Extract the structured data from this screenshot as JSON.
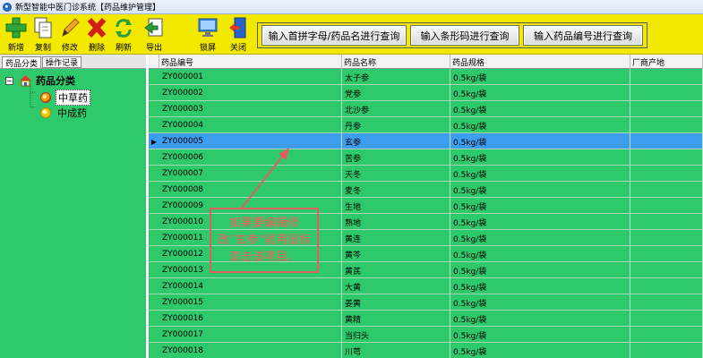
{
  "window": {
    "title": "新型智能中医门诊系统【药品维护管理】"
  },
  "toolbar": {
    "add": "新增",
    "copy": "复制",
    "edit": "修改",
    "delete": "删除",
    "refresh": "刷新",
    "export": "导出",
    "lock": "锁屏",
    "close": "关闭",
    "query_pinyin": "输入首拼字母/药品名进行查询",
    "query_barcode": "输入条形码进行查询",
    "query_code": "输入药品编号进行查询"
  },
  "left": {
    "tabs": [
      "药品分类",
      "操作记录"
    ],
    "tree_root": "药品分类",
    "tree_items": [
      "中草药",
      "中成药"
    ]
  },
  "grid": {
    "columns": [
      "药品编号",
      "药品名称",
      "药品规格",
      "厂商产地"
    ],
    "rows": [
      [
        "ZY000001",
        "太子参",
        "0.5kg/袋",
        ""
      ],
      [
        "ZY000002",
        "党参",
        "0.5kg/袋",
        ""
      ],
      [
        "ZY000003",
        "北沙参",
        "0.5kg/袋",
        ""
      ],
      [
        "ZY000004",
        "丹参",
        "0.5kg/袋",
        ""
      ],
      [
        "ZY000005",
        "玄参",
        "0.5kg/袋",
        ""
      ],
      [
        "ZY000006",
        "苦参",
        "0.5kg/袋",
        ""
      ],
      [
        "ZY000007",
        "天冬",
        "0.5kg/袋",
        ""
      ],
      [
        "ZY000008",
        "麦冬",
        "0.5kg/袋",
        ""
      ],
      [
        "ZY000009",
        "生地",
        "0.5kg/袋",
        ""
      ],
      [
        "ZY000010",
        "熟地",
        "0.5kg/袋",
        ""
      ],
      [
        "ZY000011",
        "黄连",
        "0.5kg/袋",
        ""
      ],
      [
        "ZY000012",
        "黄芩",
        "0.5kg/袋",
        ""
      ],
      [
        "ZY000013",
        "黄芪",
        "0.5kg/袋",
        ""
      ],
      [
        "ZY000014",
        "大黄",
        "0.5kg/袋",
        ""
      ],
      [
        "ZY000015",
        "姜黄",
        "0.5kg/袋",
        ""
      ],
      [
        "ZY000016",
        "黄精",
        "0.5kg/袋",
        ""
      ],
      [
        "ZY000017",
        "当归头",
        "0.5kg/袋",
        ""
      ],
      [
        "ZY000018",
        "川芎",
        "0.5kg/袋",
        ""
      ]
    ],
    "selected_row_marker": "▶"
  },
  "annotation": {
    "text": "如果要编辑修改“玄参”就用鼠标双击该项目。"
  },
  "colors": {
    "toolbar_bg": "#f2e800",
    "panel_bg": "#2dc96a",
    "selected_row": "#3d9ef0",
    "annotation": "#e06060"
  }
}
